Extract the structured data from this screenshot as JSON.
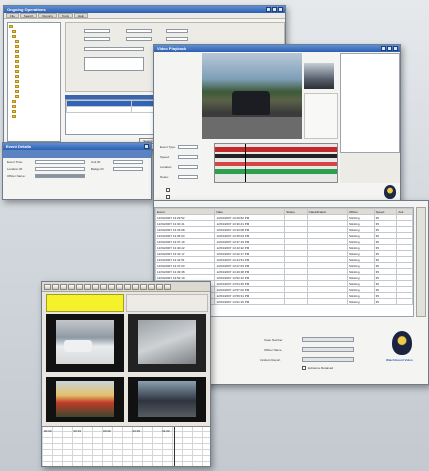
{
  "window_a": {
    "title": "Ongoing Operations",
    "menu": [
      "File",
      "Search",
      "Reports",
      "Tools",
      "Help"
    ],
    "tree_items": [
      "",
      "",
      "",
      "",
      "",
      "",
      "",
      "",
      "",
      "",
      "",
      "",
      "",
      "",
      "",
      "",
      "",
      "",
      ""
    ],
    "buttons": [
      "Search",
      "Cancel",
      "Reset"
    ]
  },
  "window_b": {
    "title": "Event Details",
    "labels": [
      "Event Time:",
      "Location ID:",
      "Officer Name:",
      "Unit ID:",
      "Badge ID:"
    ]
  },
  "window_c": {
    "title": "Video Playback",
    "labels": [
      "Event Type:",
      "Speed:",
      "Location:",
      "Notes:"
    ]
  },
  "window_d": {
    "columns": [
      "Event",
      "Date",
      "Status",
      "Classification",
      "Officer",
      "Speed",
      "Ack"
    ],
    "rows": [
      [
        "12/04/2007 13:29:52",
        "12/04/2007 13:29:52 PM",
        "",
        "",
        "Stinking",
        "35",
        ""
      ],
      [
        "12/04/2007 13:30:41",
        "12/04/2007 13:30:41 PM",
        "",
        "",
        "Stinking",
        "35",
        ""
      ],
      [
        "12/04/2007 13:33:08",
        "12/04/2007 13:33:08 PM",
        "",
        "",
        "Stinking",
        "35",
        ""
      ],
      [
        "12/04/2007 13:35:04",
        "12/04/2007 13:35:04 PM",
        "",
        "",
        "Stinking",
        "35",
        ""
      ],
      [
        "12/04/2007 13:37:19",
        "12/04/2007 13:37:19 PM",
        "",
        "",
        "Stinking",
        "35",
        ""
      ],
      [
        "12/04/2007 13:40:22",
        "12/04/2007 13:40:22 PM",
        "",
        "",
        "Stinking",
        "35",
        ""
      ],
      [
        "12/04/2007 13:42:17",
        "12/04/2007 13:42:17 PM",
        "",
        "",
        "Stinking",
        "35",
        ""
      ],
      [
        "12/04/2007 13:44:51",
        "12/04/2007 13:44:51 PM",
        "",
        "",
        "Stinking",
        "35",
        ""
      ],
      [
        "12/04/2007 13:47:03",
        "12/04/2007 13:47:03 PM",
        "",
        "",
        "Stinking",
        "35",
        ""
      ],
      [
        "12/04/2007 13:49:38",
        "12/04/2007 13:49:38 PM",
        "",
        "",
        "Stinking",
        "35",
        ""
      ],
      [
        "12/04/2007 13:52:10",
        "12/04/2007 13:52:10 PM",
        "",
        "",
        "Stinking",
        "35",
        ""
      ],
      [
        "12/04/2007 13:54:45",
        "12/04/2007 13:54:45 PM",
        "",
        "",
        "Stinking",
        "35",
        ""
      ],
      [
        "12/04/2007 13:57:02",
        "12/04/2007 13:57:02 PM",
        "",
        "",
        "Stinking",
        "35",
        ""
      ],
      [
        "12/04/2007 13:59:31",
        "12/04/2007 13:59:31 PM",
        "",
        "",
        "Stinking",
        "35",
        ""
      ],
      [
        "12/04/2007 14:01:16",
        "12/04/2007 14:01:16 PM",
        "",
        "",
        "Stinking",
        "35",
        ""
      ]
    ],
    "footer_labels": [
      "Case Number",
      "Officer Name",
      "Incident Report"
    ],
    "footer_check": "Evidence Retained",
    "brand_text": "WatchGuard Video"
  },
  "window_e": {
    "timeline_labels": [
      "00:00",
      "00:15",
      "00:30",
      "00:45",
      "01:00"
    ],
    "toolbar_count": 16
  },
  "colors": {
    "title_blue": "#2f5fb0",
    "yellow_header": "#f5f12a",
    "timeline_red": "#c42929",
    "timeline_green": "#2ca14a",
    "selection_blue": "#3163b8"
  }
}
